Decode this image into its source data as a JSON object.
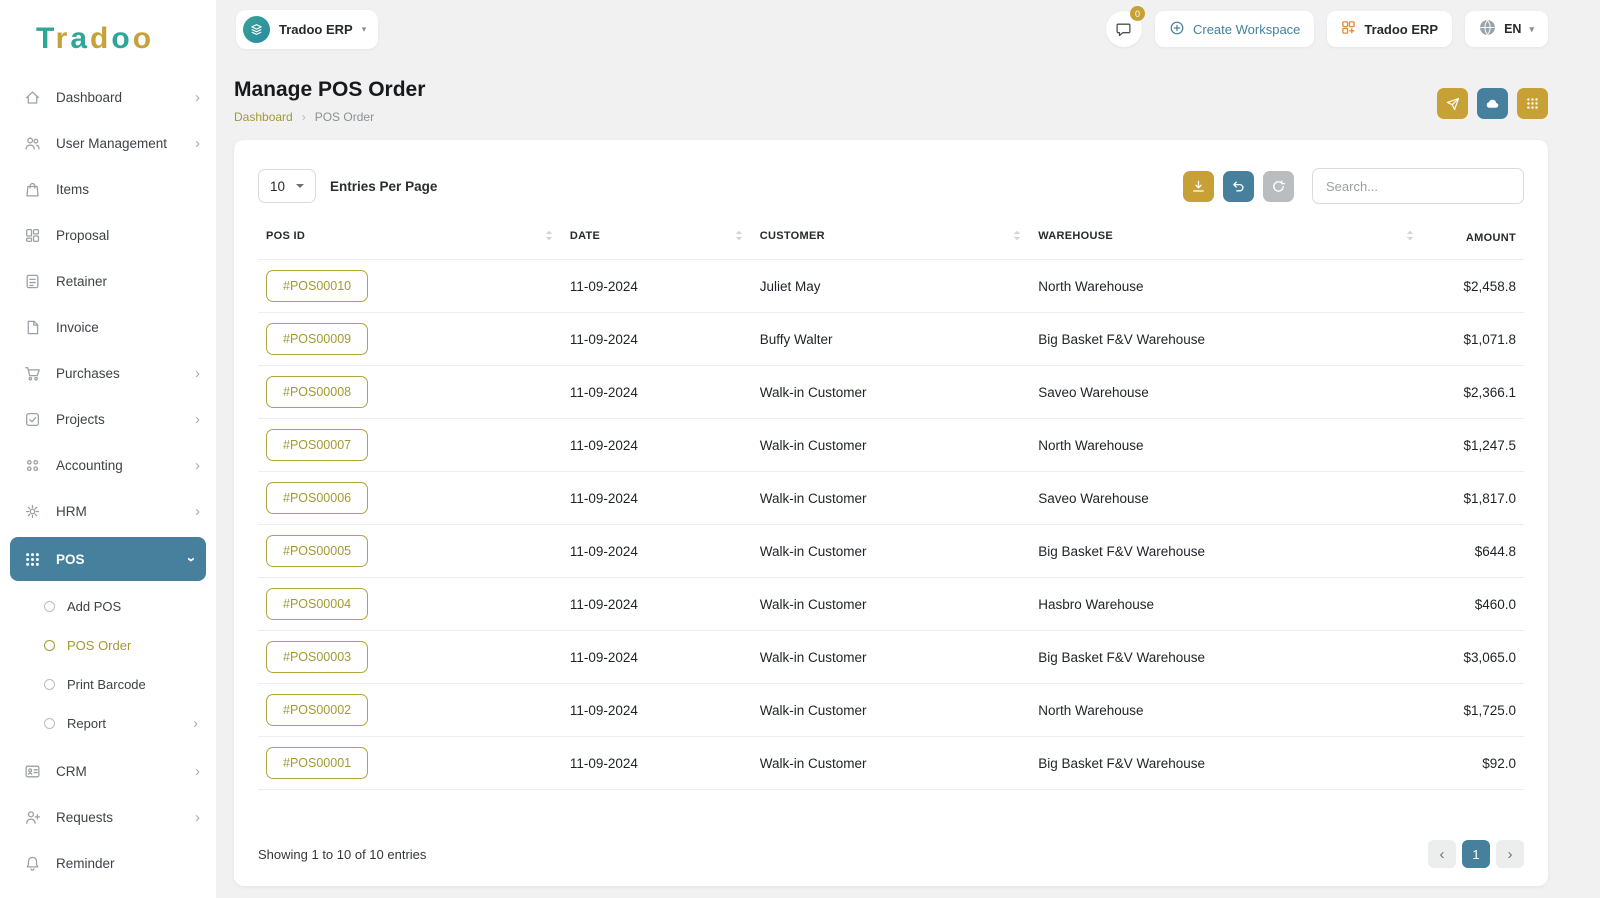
{
  "colors": {
    "gold": "#c8a136",
    "gold_text": "#a39a31",
    "teal": "#47809d"
  },
  "logo": {
    "letters": [
      {
        "ch": "T",
        "color": "#2ea796"
      },
      {
        "ch": "r",
        "color": "#c7a23a"
      },
      {
        "ch": "a",
        "color": "#2ea796"
      },
      {
        "ch": "d",
        "color": "#c7a23a"
      },
      {
        "ch": "o",
        "color": "#2ea796"
      },
      {
        "ch": "o",
        "color": "#c7a23a"
      }
    ]
  },
  "topbar": {
    "workspace_label": "Tradoo ERP",
    "chat_badge": "0",
    "create_workspace_label": "Create Workspace",
    "erp_button_label": "Tradoo ERP",
    "language": "EN"
  },
  "sidebar": {
    "items": [
      {
        "label": "Dashboard",
        "icon": "home",
        "chevron": true
      },
      {
        "label": "User Management",
        "icon": "users",
        "chevron": true
      },
      {
        "label": "Items",
        "icon": "bag"
      },
      {
        "label": "Proposal",
        "icon": "kanban"
      },
      {
        "label": "Retainer",
        "icon": "doc-lines"
      },
      {
        "label": "Invoice",
        "icon": "invoice"
      },
      {
        "label": "Purchases",
        "icon": "cart",
        "chevron": true
      },
      {
        "label": "Projects",
        "icon": "check-square",
        "chevron": true
      },
      {
        "label": "Accounting",
        "icon": "dots-four",
        "chevron": true
      },
      {
        "label": "HRM",
        "icon": "hub",
        "chevron": true
      },
      {
        "label": "POS",
        "icon": "dots-grid",
        "active": true,
        "expanded": true,
        "submenu": [
          {
            "label": "Add POS"
          },
          {
            "label": "POS Order",
            "active": true
          },
          {
            "label": "Print Barcode"
          },
          {
            "label": "Report",
            "chevron": true
          }
        ]
      },
      {
        "label": "CRM",
        "icon": "id-card",
        "chevron": true
      },
      {
        "label": "Requests",
        "icon": "user-plus",
        "chevron": true
      },
      {
        "label": "Reminder",
        "icon": "bell"
      }
    ]
  },
  "page": {
    "title": "Manage POS Order",
    "breadcrumb_home": "Dashboard",
    "breadcrumb_current": "POS Order"
  },
  "controls": {
    "entries_value": "10",
    "entries_label": "Entries Per Page",
    "search_placeholder": "Search..."
  },
  "table": {
    "columns": [
      {
        "label": "POS ID",
        "sortable": true
      },
      {
        "label": "DATE",
        "sortable": true
      },
      {
        "label": "CUSTOMER",
        "sortable": true
      },
      {
        "label": "WAREHOUSE",
        "sortable": true
      },
      {
        "label": "AMOUNT",
        "sortable": false,
        "align": "right"
      }
    ],
    "rows": [
      {
        "pos_id": "#POS00010",
        "date": "11-09-2024",
        "customer": "Juliet May",
        "warehouse": "North Warehouse",
        "amount": "$2,458.8"
      },
      {
        "pos_id": "#POS00009",
        "date": "11-09-2024",
        "customer": "Buffy Walter",
        "warehouse": "Big Basket F&V Warehouse",
        "amount": "$1,071.8"
      },
      {
        "pos_id": "#POS00008",
        "date": "11-09-2024",
        "customer": "Walk-in Customer",
        "warehouse": "Saveo Warehouse",
        "amount": "$2,366.1"
      },
      {
        "pos_id": "#POS00007",
        "date": "11-09-2024",
        "customer": "Walk-in Customer",
        "warehouse": "North Warehouse",
        "amount": "$1,247.5"
      },
      {
        "pos_id": "#POS00006",
        "date": "11-09-2024",
        "customer": "Walk-in Customer",
        "warehouse": "Saveo Warehouse",
        "amount": "$1,817.0"
      },
      {
        "pos_id": "#POS00005",
        "date": "11-09-2024",
        "customer": "Walk-in Customer",
        "warehouse": "Big Basket F&V Warehouse",
        "amount": "$644.8"
      },
      {
        "pos_id": "#POS00004",
        "date": "11-09-2024",
        "customer": "Walk-in Customer",
        "warehouse": "Hasbro Warehouse",
        "amount": "$460.0"
      },
      {
        "pos_id": "#POS00003",
        "date": "11-09-2024",
        "customer": "Walk-in Customer",
        "warehouse": "Big Basket F&V Warehouse",
        "amount": "$3,065.0"
      },
      {
        "pos_id": "#POS00002",
        "date": "11-09-2024",
        "customer": "Walk-in Customer",
        "warehouse": "North Warehouse",
        "amount": "$1,725.0"
      },
      {
        "pos_id": "#POS00001",
        "date": "11-09-2024",
        "customer": "Walk-in Customer",
        "warehouse": "Big Basket F&V Warehouse",
        "amount": "$92.0"
      }
    ]
  },
  "footer": {
    "showing_text": "Showing 1 to 10 of 10 entries",
    "current_page": "1"
  }
}
